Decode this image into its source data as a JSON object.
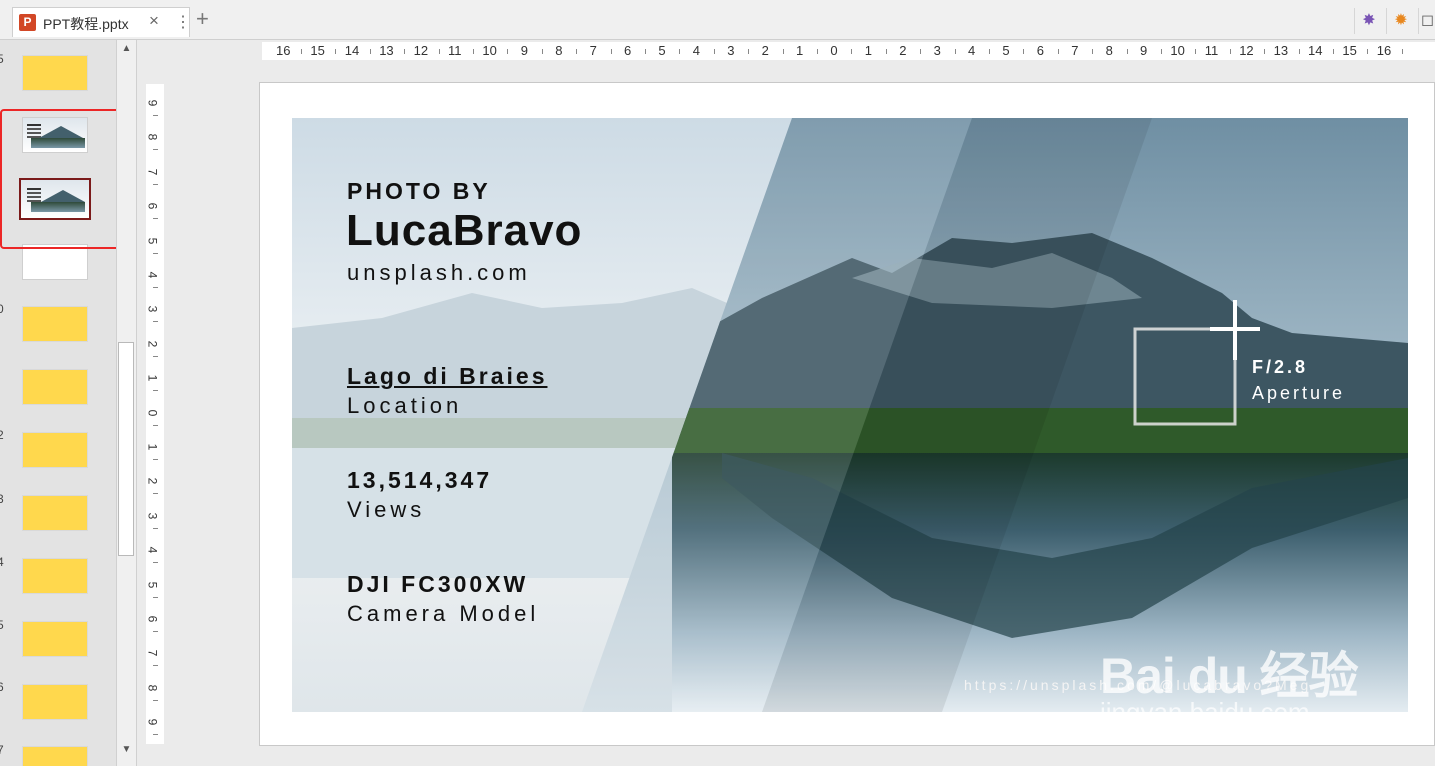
{
  "tab": {
    "title": "PPT教程.pptx",
    "close": "×",
    "more": "⋮",
    "add": "+",
    "icon_letter": "P"
  },
  "toolbar_right": [
    {
      "icon": "wand-icon",
      "glyph": "✸"
    },
    {
      "icon": "settings-icon",
      "glyph": "✹"
    },
    {
      "icon": "window-icon",
      "glyph": "◻"
    }
  ],
  "thumbnails": {
    "numbers": [
      "5",
      "0",
      "2",
      "3",
      "4",
      "5",
      "6",
      "7"
    ],
    "items": [
      "yellow",
      "image",
      "image-selected",
      "white",
      "yellow",
      "yellow",
      "yellow",
      "yellow",
      "yellow",
      "yellow",
      "yellow",
      "yellow"
    ]
  },
  "scroll": {
    "up": "▲",
    "down": "▼"
  },
  "ruler": {
    "horizontal": [
      "16",
      "15",
      "14",
      "13",
      "12",
      "11",
      "10",
      "9",
      "8",
      "7",
      "6",
      "5",
      "4",
      "3",
      "2",
      "1",
      "0",
      "1",
      "2",
      "3",
      "4",
      "5",
      "6",
      "7",
      "8",
      "9",
      "10",
      "11",
      "12",
      "13",
      "14",
      "15",
      "16"
    ],
    "vertical": [
      "9",
      "8",
      "7",
      "6",
      "5",
      "4",
      "3",
      "2",
      "1",
      "0",
      "1",
      "2",
      "3",
      "4",
      "5",
      "6",
      "7",
      "8",
      "9"
    ]
  },
  "slide": {
    "photo_by": "PHOTO BY",
    "name": "LucaBravo",
    "site": "unsplash.com",
    "location_value": "Lago di Braies",
    "location_label": "Location",
    "views_value": "13,514,347",
    "views_label": "Views",
    "camera_value": "DJI FC300XW",
    "camera_label": "Camera Model",
    "aperture_value": "F/2.8",
    "aperture_label": "Aperture",
    "url": "https://unsplash.com/@lucabravo?Meg"
  },
  "watermark": {
    "line1": "Bai du 经验",
    "line2": "jingyan.baidu.com"
  },
  "colors": {
    "accent_red": "#ec2626",
    "thumb_yellow": "#ffd84d",
    "selected_border": "#7b1a1a",
    "ppt_icon": "#d24726"
  }
}
